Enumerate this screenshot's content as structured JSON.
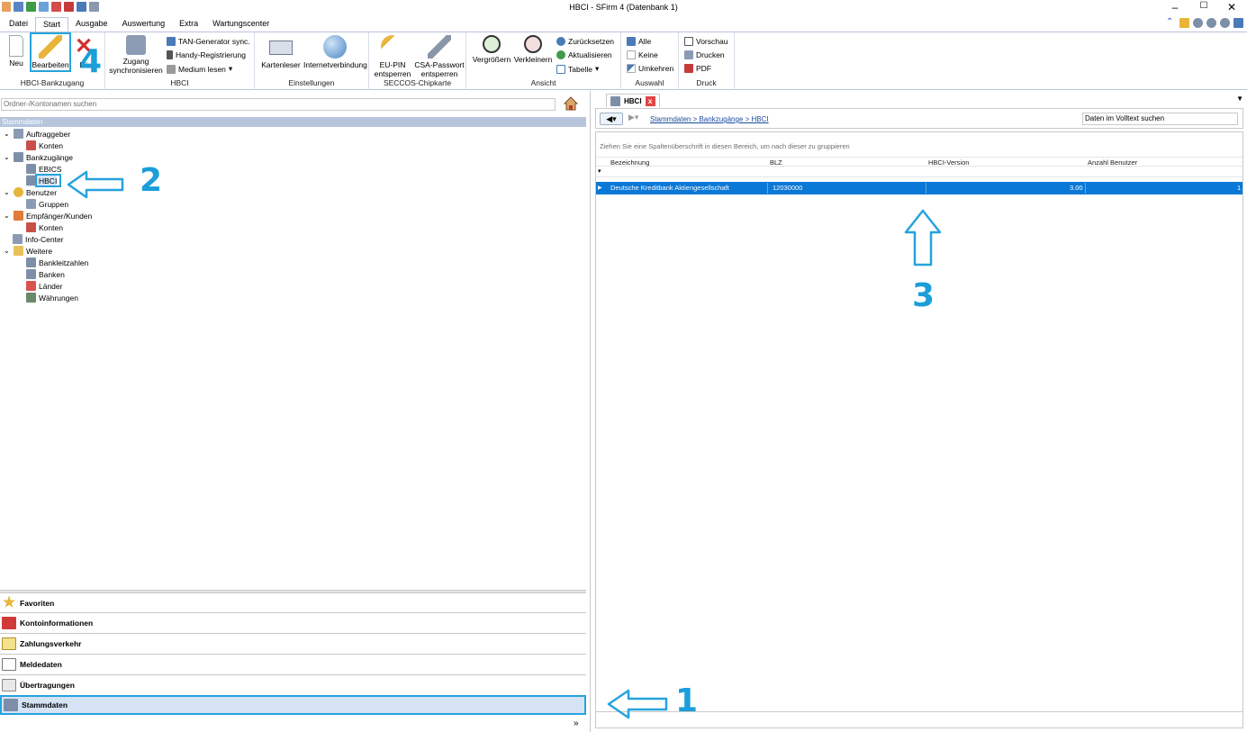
{
  "window": {
    "title": "HBCI - SFirm 4 (Datenbank 1)",
    "minimize": "–",
    "maximize": "☐",
    "close": "✕"
  },
  "menu_tabs": [
    "Datei",
    "Start",
    "Ausgabe",
    "Auswertung",
    "Extra",
    "Wartungscenter"
  ],
  "ribbon": {
    "hbci_bankzugang": {
      "label": "HBCI-Bankzugang",
      "neu": "Neu",
      "bearbeiten": "Bearbeiten",
      "loeschen": "Lö"
    },
    "hbci": {
      "label": "HBCI",
      "zugang": "Zugang",
      "zugang2": "synchronisieren",
      "tan": "TAN-Generator sync.",
      "handy": "Handy-Registrierung",
      "medium": "Medium lesen"
    },
    "einstellungen": {
      "label": "Einstellungen",
      "kartenleser": "Kartenleser",
      "internet": "Internetverbindung"
    },
    "seccos": {
      "label": "SECCOS-Chipkarte",
      "eupin": "EU-PIN",
      "eupin2": "entsperren",
      "csa": "CSA-Passwort",
      "csa2": "entsperren"
    },
    "ansicht": {
      "label": "Ansicht",
      "vergroessern": "Vergrößern",
      "verkleinern": "Verkleinern",
      "zurueck": "Zurücksetzen",
      "aktualisieren": "Aktualisieren",
      "tabelle": "Tabelle"
    },
    "auswahl": {
      "label": "Auswahl",
      "alle": "Alle",
      "keine": "Keine",
      "umkehren": "Umkehren"
    },
    "druck": {
      "label": "Druck",
      "vorschau": "Vorschau",
      "drucken": "Drucken",
      "pdf": "PDF"
    }
  },
  "left": {
    "search_placeholder": "Ordner-/Kontonamen suchen",
    "section": "Stammdaten",
    "tree": {
      "auftraggeber": "Auftraggeber",
      "konten1": "Konten",
      "bankzugaenge": "Bankzugänge",
      "ebics": "EBICS",
      "hbci": "HBCI",
      "benutzer": "Benutzer",
      "gruppen": "Gruppen",
      "empfaenger": "Empfänger/Kunden",
      "konten2": "Konten",
      "infocenter": "Info-Center",
      "weitere": "Weitere",
      "blz": "Bankleitzahlen",
      "banken": "Banken",
      "laender": "Länder",
      "waehrungen": "Währungen"
    },
    "nav": [
      "Favoriten",
      "Kontoinformationen",
      "Zahlungsverkehr",
      "Meldedaten",
      "Übertragungen",
      "Stammdaten"
    ]
  },
  "right": {
    "tab": "HBCI",
    "tab_close": "x",
    "breadcrumb": "Stammdaten > Bankzugänge > HBCI",
    "fulltext_placeholder": "Daten im Volltext suchen",
    "group_hint": "Ziehen Sie eine Spaltenüberschrift in diesen Bereich, um nach dieser zu gruppieren",
    "columns": [
      "Bezeichnung",
      "BLZ",
      "HBCI-Version",
      "Anzahl Benutzer"
    ],
    "row": {
      "bezeichnung": "Deutsche Kreditbank Aktiengesellschaft",
      "blz": "12030000",
      "version": "3.00",
      "benutzer": "1"
    }
  },
  "annotations": [
    "1",
    "2",
    "3",
    "4"
  ],
  "colors": {
    "highlight": "#27a3dd",
    "selection": "#0a78d6"
  }
}
